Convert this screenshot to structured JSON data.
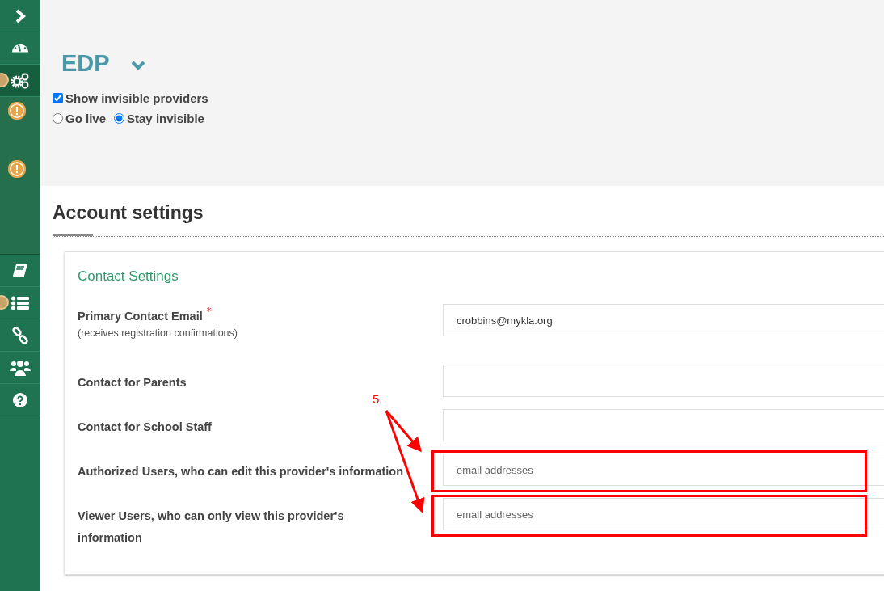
{
  "sidebar": {
    "items": [
      {
        "kind": "chevron",
        "selected": false,
        "badge": false
      },
      {
        "kind": "gauge",
        "selected": false,
        "badge": false
      },
      {
        "kind": "gears",
        "selected": true,
        "badge": true
      },
      {
        "kind": "subtree",
        "selected": false,
        "badge": false
      },
      {
        "kind": "book",
        "selected": false,
        "badge": false
      },
      {
        "kind": "list",
        "selected": false,
        "badge": true
      },
      {
        "kind": "link",
        "selected": false,
        "badge": false
      },
      {
        "kind": "users",
        "selected": false,
        "badge": false
      },
      {
        "kind": "help",
        "selected": false,
        "badge": false
      }
    ]
  },
  "header": {
    "title": "EDP",
    "show_invisible": {
      "label": "Show invisible providers",
      "checked": true
    },
    "visibility": [
      {
        "label": "Go live",
        "selected": false
      },
      {
        "label": "Stay invisible",
        "selected": true
      }
    ]
  },
  "section_title": "Account settings",
  "card": {
    "title": "Contact Settings",
    "fields": [
      {
        "label": "Primary Contact Email",
        "required_mark": "*",
        "hint": "(receives registration confirmations)",
        "value": "crobbins@mykla.org",
        "highlighted": false
      },
      {
        "label": "Contact for Parents",
        "highlighted": false
      },
      {
        "label": "Contact for School Staff",
        "highlighted": false
      },
      {
        "label": "Authorized Users, who can edit this provider's information",
        "placeholder": "email addresses",
        "highlighted": true
      },
      {
        "label": "Viewer Users, who can only view this provider's information",
        "placeholder": "email addresses",
        "highlighted": true
      }
    ]
  },
  "annotation": {
    "label": "5"
  }
}
